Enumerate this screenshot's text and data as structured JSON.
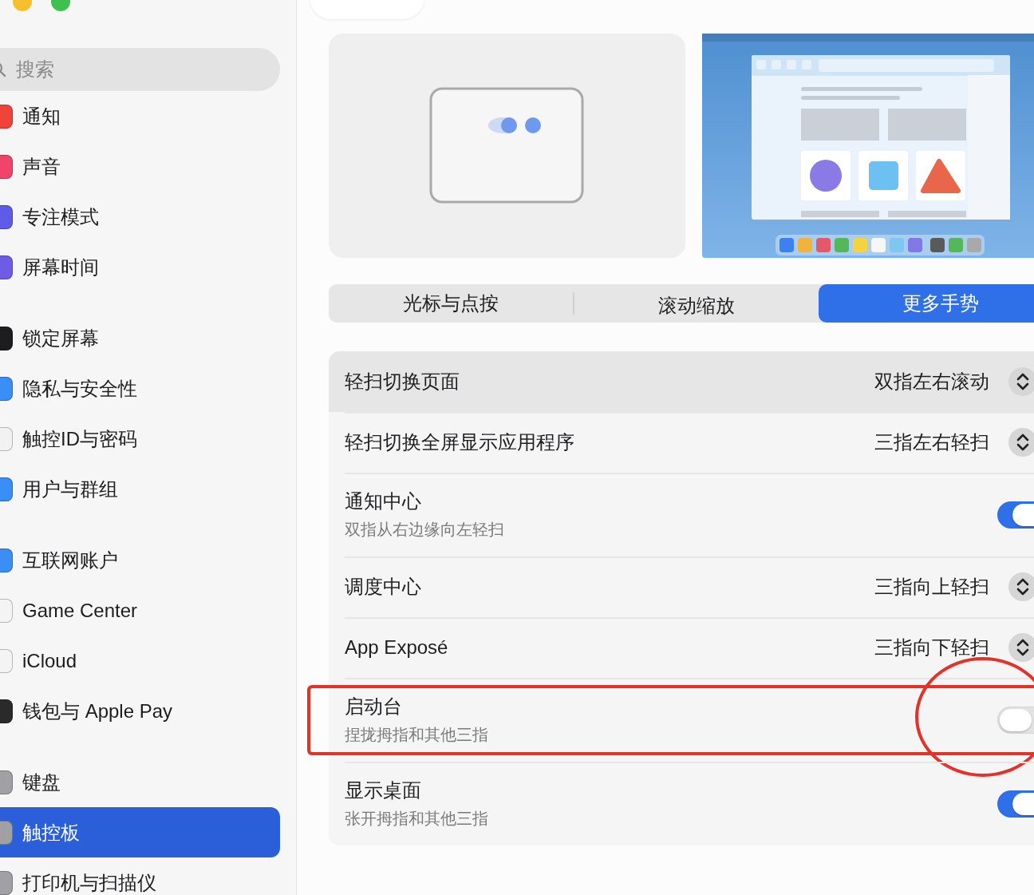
{
  "sidebar": {
    "search": {
      "placeholder": "搜索"
    },
    "groups": [
      [
        {
          "label": "通知",
          "selected": false,
          "color": "#f0443a"
        },
        {
          "label": "声音",
          "selected": false,
          "color": "#f0446a"
        },
        {
          "label": "专注模式",
          "selected": false,
          "color": "#5e5ce6"
        },
        {
          "label": "屏幕时间",
          "selected": false,
          "color": "#6e5ce6"
        }
      ],
      [
        {
          "label": "锁定屏幕",
          "selected": false,
          "color": "#1d1d1f"
        },
        {
          "label": "隐私与安全性",
          "selected": false,
          "color": "#3a8ef6"
        },
        {
          "label": "触控ID与密码",
          "selected": false,
          "color": "#f2f2f2"
        },
        {
          "label": "用户与群组",
          "selected": false,
          "color": "#3a8ef6"
        }
      ],
      [
        {
          "label": "互联网账户",
          "selected": false,
          "color": "#3a8ef6"
        },
        {
          "label": "Game Center",
          "selected": false,
          "color": "#f4f4f4"
        },
        {
          "label": "iCloud",
          "selected": false,
          "color": "#f4f4f4"
        },
        {
          "label": "钱包与 Apple Pay",
          "selected": false,
          "color": "#2a2a2a"
        }
      ],
      [
        {
          "label": "键盘",
          "selected": false,
          "color": "#a0a0a5"
        },
        {
          "label": "触控板",
          "selected": true,
          "color": "#a0a0a5"
        },
        {
          "label": "打印机与扫描仪",
          "selected": false,
          "color": "#a0a0a5"
        }
      ]
    ]
  },
  "tabs": [
    {
      "label": "光标与点按",
      "selected": false
    },
    {
      "label": "滚动缩放",
      "selected": false
    },
    {
      "label": "更多手势",
      "selected": true
    }
  ],
  "settings": [
    {
      "kind": "select",
      "title": "轻扫切换页面",
      "value": "双指左右滚动",
      "highlighted": true,
      "circled": false
    },
    {
      "kind": "select",
      "title": "轻扫切换全屏显示应用程序",
      "value": "三指左右轻扫",
      "highlighted": false,
      "circled": false
    },
    {
      "kind": "toggle",
      "title": "通知中心",
      "subtitle": "双指从右边缘向左轻扫",
      "on": true,
      "highlighted": false,
      "circled": false
    },
    {
      "kind": "select",
      "title": "调度中心",
      "value": "三指向上轻扫",
      "highlighted": false,
      "circled": false
    },
    {
      "kind": "select",
      "title": "App Exposé",
      "value": "三指向下轻扫",
      "highlighted": false,
      "circled": false
    },
    {
      "kind": "toggle",
      "title": "启动台",
      "subtitle": "捏拢拇指和其他三指",
      "on": false,
      "highlighted": false,
      "circled": true
    },
    {
      "kind": "toggle",
      "title": "显示桌面",
      "subtitle": "张开拇指和其他三指",
      "on": true,
      "highlighted": false,
      "circled": false
    }
  ]
}
